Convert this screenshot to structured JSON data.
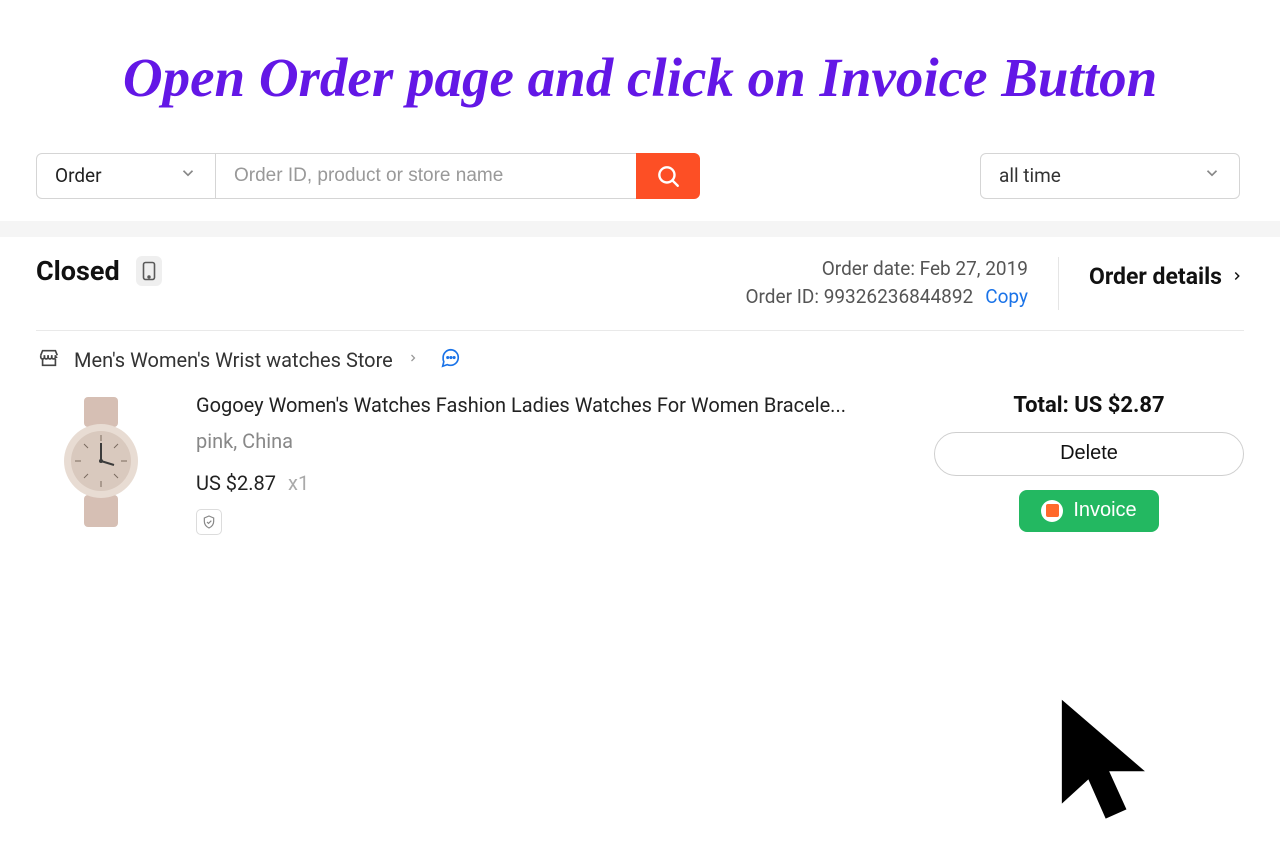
{
  "heading": "Open Order page and click on Invoice Button",
  "toolbar": {
    "type_select": "Order",
    "search_placeholder": "Order ID, product or store name",
    "time_select": "all time"
  },
  "order": {
    "status": "Closed",
    "date_label": "Order date:",
    "date_value": "Feb 27, 2019",
    "id_label": "Order ID:",
    "id_value": "99326236844892",
    "copy_label": "Copy",
    "details_label": "Order details",
    "store_name": "Men's Women's Wrist watches Store",
    "product_title": "Gogoey Women's Watches Fashion Ladies Watches For Women Bracele...",
    "variant": "pink, China",
    "unit_price": "US $2.87",
    "qty": "x1",
    "total_label": "Total:",
    "total_value": "US $2.87",
    "delete_label": "Delete",
    "invoice_label": "Invoice"
  }
}
